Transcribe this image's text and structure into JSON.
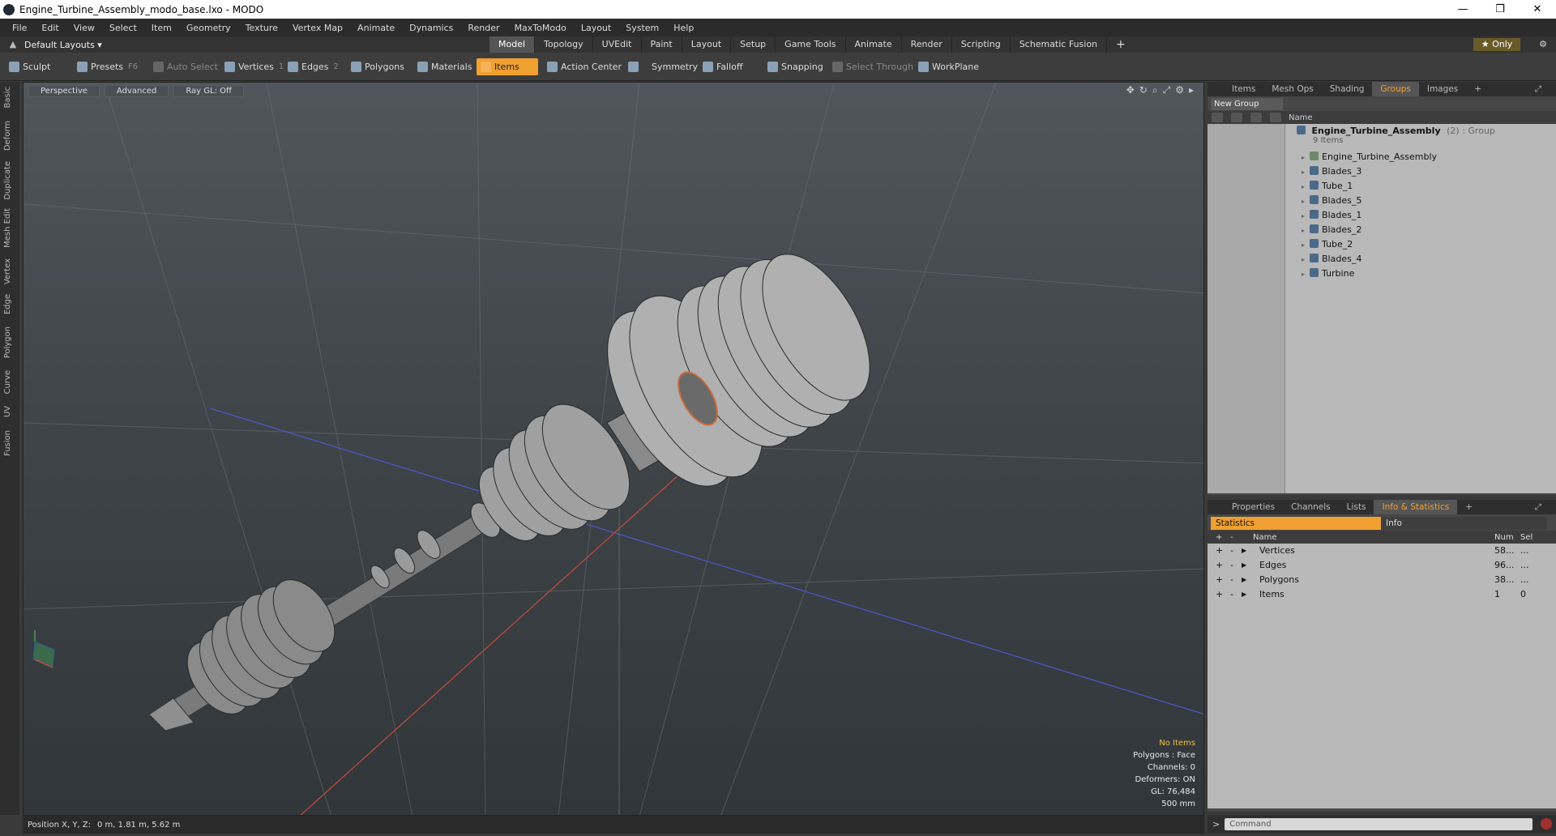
{
  "window": {
    "title": "Engine_Turbine_Assembly_modo_base.lxo - MODO",
    "controls": [
      "—",
      "❐",
      "✕"
    ]
  },
  "menu": [
    "File",
    "Edit",
    "View",
    "Select",
    "Item",
    "Geometry",
    "Texture",
    "Vertex Map",
    "Animate",
    "Dynamics",
    "Render",
    "MaxToModo",
    "Layout",
    "System",
    "Help"
  ],
  "layoutbar": {
    "layout_name": "Default Layouts ▾",
    "tabs": [
      "Model",
      "Topology",
      "UVEdit",
      "Paint",
      "Layout",
      "Setup",
      "Game Tools",
      "Animate",
      "Render",
      "Scripting",
      "Schematic Fusion"
    ],
    "active_tab": "Model",
    "only_label": "★ Only"
  },
  "toolbar": {
    "sculpt": "Sculpt",
    "presets": "Presets",
    "presets_key": "F6",
    "auto_select": "Auto Select",
    "vertices": "Vertices",
    "vertices_key": "1",
    "edges": "Edges",
    "edges_key": "2",
    "polygons": "Polygons",
    "materials": "Materials",
    "items": "Items",
    "action_center": "Action Center",
    "symmetry": "Symmetry",
    "falloff": "Falloff",
    "snapping": "Snapping",
    "select_through": "Select Through",
    "workplane": "WorkPlane"
  },
  "lefttabs": [
    "Basic",
    "Deform",
    "Duplicate",
    "Mesh Edit",
    "Vertex",
    "Edge",
    "Polygon",
    "Curve",
    "UV",
    "Fusion"
  ],
  "viewport": {
    "view": "Perspective",
    "shading": "Advanced",
    "raygl": "Ray GL: Off",
    "info": {
      "selection": "No Items",
      "polygons": "Polygons : Face",
      "channels": "Channels: 0",
      "deformers": "Deformers: ON",
      "gl": "GL: 76,484",
      "scale": "500 mm"
    }
  },
  "status": {
    "label": "Position X, Y, Z:",
    "value": "0 m, 1.81 m, 5.62 m"
  },
  "groups_panel": {
    "tabs": [
      "Items",
      "Mesh Ops",
      "Shading",
      "Groups",
      "Images",
      "+"
    ],
    "active_tab": "Groups",
    "new_group": "New Group",
    "name_header": "Name",
    "group_name": "Engine_Turbine_Assembly",
    "group_suffix": "(2) : Group",
    "group_count": "9 Items",
    "items": [
      "Engine_Turbine_Assembly",
      "Blades_3",
      "Tube_1",
      "Blades_5",
      "Blades_1",
      "Blades_2",
      "Tube_2",
      "Blades_4",
      "Turbine"
    ]
  },
  "stats_panel": {
    "tabs": [
      "Properties",
      "Channels",
      "Lists",
      "Info & Statistics",
      "+"
    ],
    "active_tab": "Info & Statistics",
    "sub_tabs": [
      "Statistics",
      "Info"
    ],
    "headers": {
      "name": "Name",
      "num": "Num",
      "sel": "Sel"
    },
    "rows": [
      {
        "name": "Vertices",
        "num": "58...",
        "sel": "..."
      },
      {
        "name": "Edges",
        "num": "96...",
        "sel": "..."
      },
      {
        "name": "Polygons",
        "num": "38...",
        "sel": "..."
      },
      {
        "name": "Items",
        "num": "1",
        "sel": "0"
      }
    ]
  },
  "command": {
    "prompt": ">",
    "placeholder": "Command"
  },
  "colors": {
    "accent": "#f0a030",
    "panel_bg": "#b9b9b9"
  }
}
